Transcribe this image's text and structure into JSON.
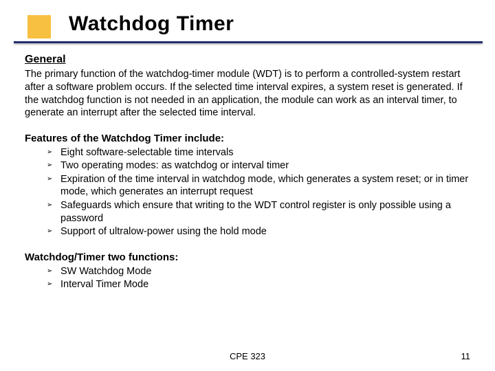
{
  "slide": {
    "title": "Watchdog Timer",
    "section_heading": "General",
    "intro_paragraph": "The primary function of the watchdog-timer module (WDT) is to perform a controlled-system restart after a software problem occurs. If the selected time interval expires, a system reset is generated. If the watchdog function is not needed in an application, the module can work as an interval timer, to generate an interrupt after the selected time interval.",
    "features_heading": "Features of the Watchdog Timer include:",
    "features": [
      "Eight software-selectable time intervals",
      "Two operating modes: as watchdog or interval timer",
      "Expiration of the time interval in watchdog mode, which generates a system reset; or in timer mode, which generates an interrupt request",
      "Safeguards which ensure that writing to the WDT control register is only possible using a password",
      "Support of ultralow-power using the hold mode"
    ],
    "functions_heading": "Watchdog/Timer two functions:",
    "functions": [
      "SW Watchdog Mode",
      "Interval Timer Mode"
    ]
  },
  "footer": {
    "course": "CPE 323",
    "page_number": "11"
  }
}
